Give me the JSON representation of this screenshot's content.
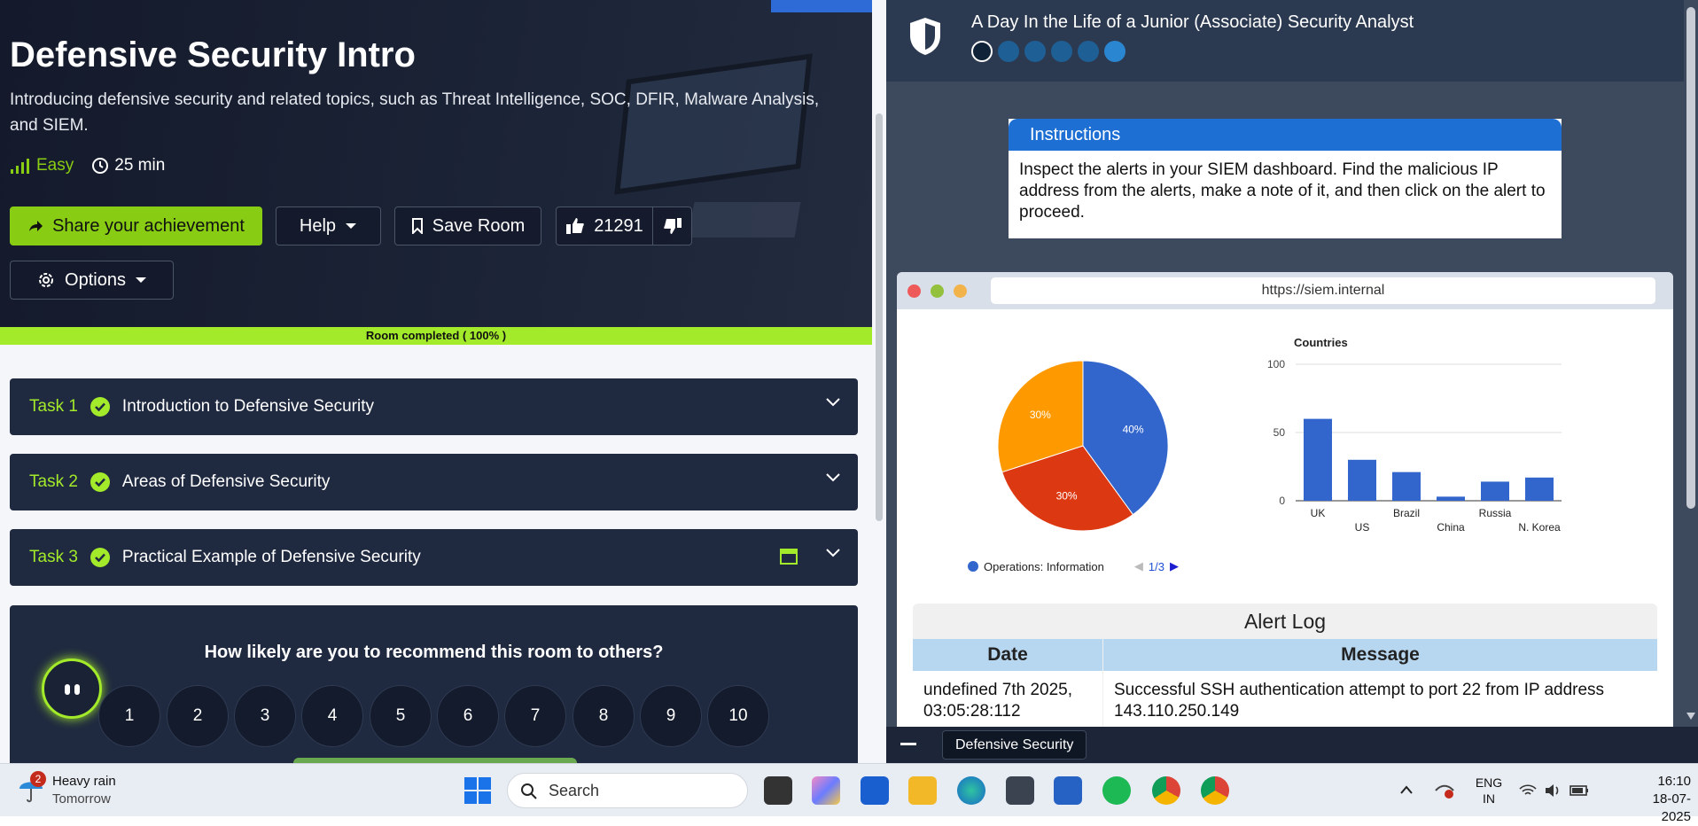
{
  "room": {
    "title": "Defensive Security Intro",
    "description": "Introducing defensive security and related topics, such as Threat Intelligence, SOC, DFIR, Malware Analysis, and SIEM.",
    "difficulty": "Easy",
    "duration": "25 min",
    "share_label": "Share your achievement",
    "help_label": "Help",
    "save_label": "Save Room",
    "likes": "21291",
    "options_label": "Options",
    "progress_text": "Room completed ( 100% )",
    "progress_value": 100
  },
  "tasks": [
    {
      "num": "Task 1",
      "title": "Introduction to Defensive Security"
    },
    {
      "num": "Task 2",
      "title": "Areas of Defensive Security"
    },
    {
      "num": "Task 3",
      "title": "Practical Example of Defensive Security"
    }
  ],
  "recommend": {
    "question": "How likely are you to recommend this room to others?",
    "ratings": [
      "1",
      "2",
      "3",
      "4",
      "5",
      "6",
      "7",
      "8",
      "9",
      "10"
    ]
  },
  "panel": {
    "title": "A Day In the Life of a Junior (Associate) Security Analyst",
    "step_count": 6,
    "instructions_title": "Instructions",
    "instructions_body": "Inspect the alerts in your SIEM dashboard. Find the malicious IP address from the alerts, make a note of it, and then click on the alert to proceed.",
    "url": "https://siem.internal",
    "pie_legend": "Operations: Information",
    "pie_page": "1/3",
    "alert_log_title": "Alert Log",
    "col_date": "Date",
    "col_message": "Message",
    "row_date": "undefined 7th 2025, 03:05:28:112",
    "row_message": "Successful SSH authentication attempt to port 22 from IP address 143.110.250.149",
    "tab_label": "Defensive Security"
  },
  "chart_data": [
    {
      "type": "pie",
      "slices": [
        {
          "label": "40%",
          "value": 40,
          "color": "#3366cc"
        },
        {
          "label": "30%",
          "value": 30,
          "color": "#dc3912"
        },
        {
          "label": "30%",
          "value": 30,
          "color": "#ff9900"
        }
      ]
    },
    {
      "type": "bar",
      "title": "Countries",
      "categories": [
        "UK",
        "US",
        "Brazil",
        "China",
        "Russia",
        "N. Korea"
      ],
      "values": [
        60,
        30,
        21,
        3,
        14,
        17
      ],
      "ylim": [
        0,
        100
      ],
      "yticks": [
        "0",
        "50",
        "100"
      ],
      "color": "#3366cc"
    }
  ],
  "taskbar": {
    "weather_badge": "2",
    "weather": "Heavy rain",
    "weather_sub": "Tomorrow",
    "search": "Search",
    "lang1": "ENG",
    "lang2": "IN",
    "time": "16:10",
    "date": "18-07-2025"
  }
}
